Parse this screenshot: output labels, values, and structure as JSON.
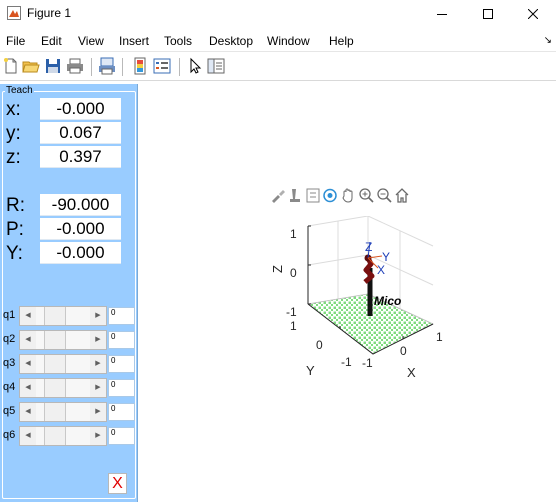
{
  "window": {
    "title": "Figure 1",
    "icon": "matlab-figure-icon"
  },
  "menu": {
    "items": [
      "File",
      "Edit",
      "View",
      "Insert",
      "Tools",
      "Desktop",
      "Window",
      "Help"
    ],
    "dock_arrow": "↘"
  },
  "toolbar": {
    "icons": [
      "new-figure-icon",
      "open-file-icon",
      "save-icon",
      "print-icon",
      "print-preview-icon",
      "insert-colorbar-icon",
      "insert-legend-icon",
      "pointer-icon",
      "property-editor-icon"
    ]
  },
  "teach": {
    "title": "Teach",
    "position": [
      {
        "label": "x:",
        "value": "-0.000"
      },
      {
        "label": "y:",
        "value": "0.067"
      },
      {
        "label": "z:",
        "value": "0.397"
      }
    ],
    "orientation": [
      {
        "label": "R:",
        "value": "-90.000"
      },
      {
        "label": "P:",
        "value": "-0.000"
      },
      {
        "label": "Y:",
        "value": "-0.000"
      }
    ],
    "joints": [
      {
        "label": "q1",
        "value": "0"
      },
      {
        "label": "q2",
        "value": "0"
      },
      {
        "label": "q3",
        "value": "0"
      },
      {
        "label": "q4",
        "value": "0"
      },
      {
        "label": "q5",
        "value": "0"
      },
      {
        "label": "q6",
        "value": "0"
      }
    ],
    "close_label": "X",
    "accent": "#99ccff"
  },
  "axes_toolbar": {
    "icons": [
      "brush-icon",
      "data-tips-icon",
      "export-icon",
      "rotate-3d-icon",
      "pan-icon",
      "zoom-in-icon",
      "zoom-out-icon",
      "home-icon"
    ]
  },
  "plot": {
    "xlabel": "X",
    "ylabel": "Y",
    "zlabel": "Z",
    "robot_name": "Mico",
    "z_ticks": [
      "1",
      "0",
      "-1"
    ],
    "y_ticks": [
      "1",
      "0",
      "-1"
    ],
    "x_ticks": [
      "-1",
      "0",
      "1"
    ],
    "frame_labels": {
      "z": "Z",
      "y": "Y",
      "x": "X"
    },
    "floor_color": "#7fdc7f"
  }
}
